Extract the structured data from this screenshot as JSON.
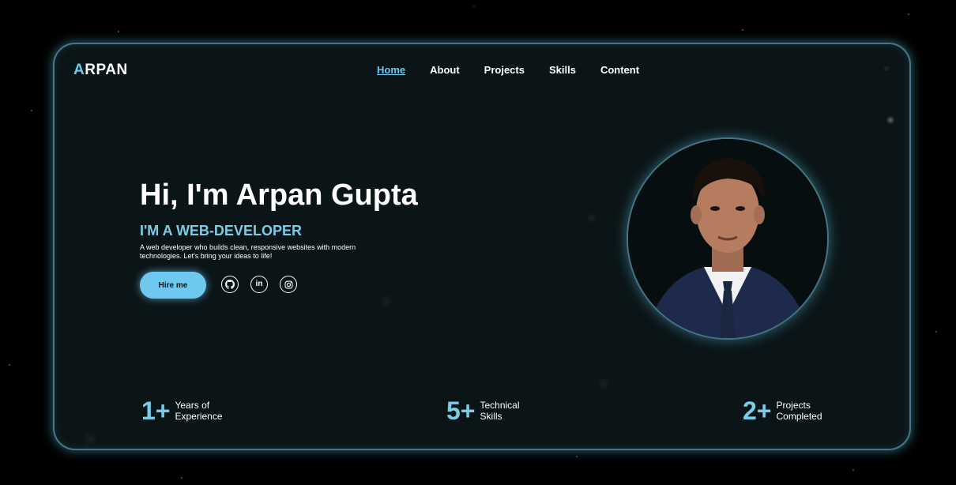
{
  "header": {
    "logo_first_letter": "A",
    "logo_rest": "RPAN",
    "nav": [
      {
        "label": "Home",
        "active": true
      },
      {
        "label": "About",
        "active": false
      },
      {
        "label": "Projects",
        "active": false
      },
      {
        "label": "Skills",
        "active": false
      },
      {
        "label": "Content",
        "active": false
      }
    ]
  },
  "hero": {
    "title": "Hi, I'm Arpan Gupta",
    "role": "I'M A WEB-DEVELOPER",
    "description": "A web developer who builds clean, responsive websites with modern technologies. Let's bring your ideas to life!",
    "cta_label": "Hire me",
    "socials": [
      {
        "icon": "github-icon"
      },
      {
        "icon": "linkedin-icon",
        "text": "in"
      },
      {
        "icon": "instagram-icon"
      }
    ]
  },
  "stats": [
    {
      "number": "1+",
      "line1": "Years of",
      "line2": "Experience"
    },
    {
      "number": "5+",
      "line1": "Technical",
      "line2": "Skills"
    },
    {
      "number": "2+",
      "line1": "Projects",
      "line2": "Completed"
    }
  ],
  "colors": {
    "accent": "#6fc9ee",
    "card_background": "#0b1517",
    "page_background": "#000000"
  }
}
